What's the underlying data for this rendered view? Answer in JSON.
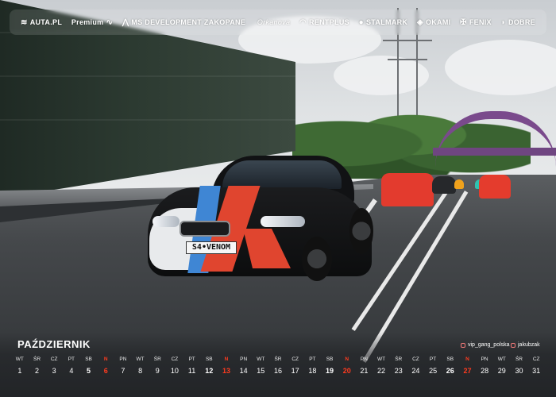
{
  "sponsors": [
    {
      "icon": "fleet-logo-icon",
      "label": "AUTA.PL"
    },
    {
      "icon": "wave-logo-icon",
      "label": "Premium"
    },
    {
      "icon": "mountain-logo-icon",
      "label": "MS DEVELOPMENT ZAKOPANE"
    },
    {
      "icon": "script-logo-icon",
      "label": "Orkanova"
    },
    {
      "icon": "car-outline-logo-icon",
      "label": "RENTPLUS"
    },
    {
      "icon": "circle-logo-icon",
      "label": "STALMARK"
    },
    {
      "icon": "shield-logo-icon",
      "label": "OKAMI"
    },
    {
      "icon": "eagle-logo-icon",
      "label": "FENIX"
    },
    {
      "icon": "d-logo-icon",
      "label": "DOBRE"
    }
  ],
  "plate": "S4•VENOM",
  "calendar": {
    "month": "PAŹDZIERNIK",
    "social": [
      {
        "icon": "instagram-icon",
        "label": "vip_gang_polska"
      },
      {
        "icon": "instagram-icon",
        "label": "jakubzak"
      }
    ],
    "sunday_color": "#ff3b1f",
    "days": [
      {
        "n": "WT",
        "d": "1"
      },
      {
        "n": "ŚR",
        "d": "2"
      },
      {
        "n": "CZ",
        "d": "3"
      },
      {
        "n": "PT",
        "d": "4"
      },
      {
        "n": "SB",
        "d": "5"
      },
      {
        "n": "N",
        "d": "6"
      },
      {
        "n": "PN",
        "d": "7"
      },
      {
        "n": "WT",
        "d": "8"
      },
      {
        "n": "ŚR",
        "d": "9"
      },
      {
        "n": "CZ",
        "d": "10"
      },
      {
        "n": "PT",
        "d": "11"
      },
      {
        "n": "SB",
        "d": "12"
      },
      {
        "n": "N",
        "d": "13"
      },
      {
        "n": "PN",
        "d": "14"
      },
      {
        "n": "WT",
        "d": "15"
      },
      {
        "n": "ŚR",
        "d": "16"
      },
      {
        "n": "CZ",
        "d": "17"
      },
      {
        "n": "PT",
        "d": "18"
      },
      {
        "n": "SB",
        "d": "19"
      },
      {
        "n": "N",
        "d": "20"
      },
      {
        "n": "PN",
        "d": "21"
      },
      {
        "n": "WT",
        "d": "22"
      },
      {
        "n": "ŚR",
        "d": "23"
      },
      {
        "n": "CZ",
        "d": "24"
      },
      {
        "n": "PT",
        "d": "25"
      },
      {
        "n": "SB",
        "d": "26"
      },
      {
        "n": "N",
        "d": "27"
      },
      {
        "n": "PN",
        "d": "28"
      },
      {
        "n": "WT",
        "d": "29"
      },
      {
        "n": "ŚR",
        "d": "30"
      },
      {
        "n": "CZ",
        "d": "31"
      }
    ]
  }
}
